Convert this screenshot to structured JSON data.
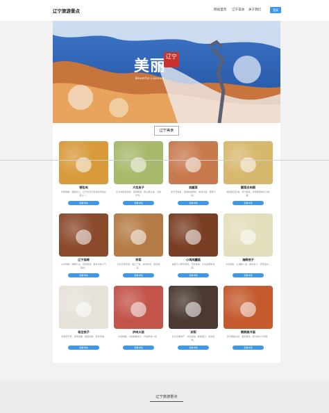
{
  "header": {
    "brand": "辽宁旅游景点",
    "nav": [
      "网站首页",
      "辽宁美食",
      "关于我们"
    ],
    "login": "登录"
  },
  "hero": {
    "title": "美丽",
    "seal": "辽宁",
    "subtitle": "Beautiful Liaoning"
  },
  "section": {
    "title": "辽宁美食"
  },
  "cards": [
    {
      "name": "锅包肉",
      "desc": "外酥里嫩，酸甜可口，辽宁最具代表性的传统名菜之一。",
      "button": "查看详情",
      "color": "#d99a3c"
    },
    {
      "name": "大拉皮子",
      "desc": "东北特色凉拌菜，爽滑筋道，配以黄瓜丝，清爽开胃。",
      "button": "查看详情",
      "color": "#a7b96a"
    },
    {
      "name": "烧酱菜",
      "desc": "老字号熟食，选用新鲜原料，酱香浓郁，肥而不腻。",
      "button": "查看详情",
      "color": "#c87a4f"
    },
    {
      "name": "酸菜白肉锅",
      "desc": "酸菜配五花肉，汤汁鲜美，冬季驱寒的东北经典。",
      "button": "查看详情",
      "color": "#d8b86e"
    },
    {
      "name": "辽宁烧烤",
      "desc": "以羊肉串、烤筋为主，孜然麻辣，夜市中的人气美食。",
      "button": "查看详情",
      "color": "#8b4a2c"
    },
    {
      "name": "拌菜",
      "desc": "东北农家拌菜，爽口下饭，食材丰富，色彩鲜亮。",
      "button": "查看详情",
      "color": "#b57b46"
    },
    {
      "name": "小鸡炖蘑菇",
      "desc": "榛蘑与小笨鸡同炖，汤浓味美，东北经典家常菜。",
      "button": "查看详情",
      "color": "#7a3e24"
    },
    {
      "name": "海鲜饺子",
      "desc": "大连特色，以海鲜入馅，鲜香多汁，皮薄馅大。",
      "button": "查看详情",
      "color": "#e3dfbd"
    },
    {
      "name": "老边饺子",
      "desc": "沈阳老字号，皮薄馅嫩，造型别致，百年传承。",
      "button": "查看详情",
      "color": "#e6e2da"
    },
    {
      "name": "炉肉火烧",
      "desc": "外皮酥脆，内馅鲜嫩多汁，传统风味小吃。",
      "button": "查看详情",
      "color": "#c2544a"
    },
    {
      "name": "冻梨",
      "desc": "东北冬季特产，冰凉甘甜，解腻爽口，别具风味。",
      "button": "查看详情",
      "color": "#4b3a32"
    },
    {
      "name": "朝鲜族冷面",
      "desc": "汤汁酸甜清凉，面条筋道，配牛肉片与鸡蛋。",
      "button": "查看详情",
      "color": "#c45a2e"
    }
  ],
  "footer": {
    "text": "辽宁旅游景点"
  }
}
